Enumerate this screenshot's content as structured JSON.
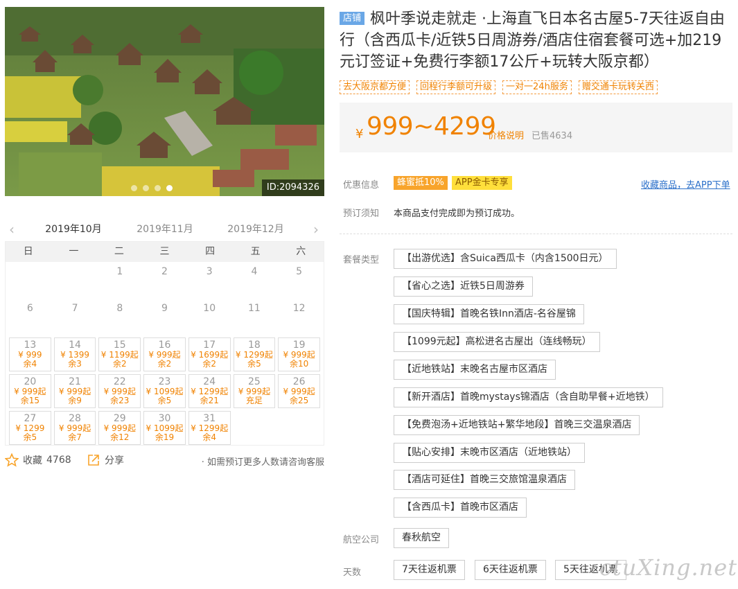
{
  "hero": {
    "id_label": "ID:2094326",
    "dots": 4,
    "active_dot": 3
  },
  "calendar": {
    "months": [
      "2019年10月",
      "2019年11月",
      "2019年12月"
    ],
    "weekdays": [
      "日",
      "一",
      "二",
      "三",
      "四",
      "五",
      "六"
    ],
    "days": [
      {
        "d": ""
      },
      {
        "d": ""
      },
      {
        "d": "1"
      },
      {
        "d": "2"
      },
      {
        "d": "3"
      },
      {
        "d": "4"
      },
      {
        "d": "5"
      },
      {
        "d": "6"
      },
      {
        "d": "7"
      },
      {
        "d": "8"
      },
      {
        "d": "9"
      },
      {
        "d": "10"
      },
      {
        "d": "11"
      },
      {
        "d": "12"
      },
      {
        "d": "13",
        "p": "¥ 999",
        "s": "余4"
      },
      {
        "d": "14",
        "p": "¥ 1399",
        "s": "余3"
      },
      {
        "d": "15",
        "p": "¥ 1199起",
        "s": "余2"
      },
      {
        "d": "16",
        "p": "¥ 999起",
        "s": "余2"
      },
      {
        "d": "17",
        "p": "¥ 1699起",
        "s": "余2"
      },
      {
        "d": "18",
        "p": "¥ 1299起",
        "s": "余5"
      },
      {
        "d": "19",
        "p": "¥ 999起",
        "s": "余10"
      },
      {
        "d": "20",
        "p": "¥ 999起",
        "s": "余15"
      },
      {
        "d": "21",
        "p": "¥ 999起",
        "s": "余9"
      },
      {
        "d": "22",
        "p": "¥ 999起",
        "s": "余23"
      },
      {
        "d": "23",
        "p": "¥ 1099起",
        "s": "余5"
      },
      {
        "d": "24",
        "p": "¥ 1299起",
        "s": "余21"
      },
      {
        "d": "25",
        "p": "¥ 999起",
        "s": "充足"
      },
      {
        "d": "26",
        "p": "¥ 999起",
        "s": "余25"
      },
      {
        "d": "27",
        "p": "¥ 1299",
        "s": "余5"
      },
      {
        "d": "28",
        "p": "¥ 999起",
        "s": "余7"
      },
      {
        "d": "29",
        "p": "¥ 999起",
        "s": "余12"
      },
      {
        "d": "30",
        "p": "¥ 1099起",
        "s": "余19"
      },
      {
        "d": "31",
        "p": "¥ 1299起",
        "s": "余4"
      }
    ]
  },
  "actions": {
    "fav_label": "收藏",
    "fav_count": "4768",
    "share_label": "分享",
    "note": "· 如需预订更多人数请咨询客服"
  },
  "product": {
    "shop_tag": "店铺",
    "title": "枫叶季说走就走 ·上海直飞日本名古屋5-7天往返自由行（含西瓜卡/近铁5日周游券/酒店住宿套餐可选+加219元订签证+免费行李额17公斤+玩转大阪京都）",
    "tags": [
      "去大阪京都方便",
      "回程行李额可升级",
      "一对一24h服务",
      "赠交通卡玩转关西"
    ],
    "price_symbol": "¥",
    "price": "999~4299",
    "price_note": "价格说明",
    "sold": "已售4634"
  },
  "promo": {
    "label": "优惠信息",
    "badge1": "蜂蜜抵10%",
    "badge2": "APP金卡专享",
    "app_link": "收藏商品，去APP下单"
  },
  "booking": {
    "label": "预订须知",
    "notice": "本商品支付完成即为预订成功。"
  },
  "package": {
    "label": "套餐类型",
    "options": [
      "【出游优选】含Suica西瓜卡（内含1500日元）",
      "【省心之选】近铁5日周游券",
      "【国庆特辑】首晚名铁Inn酒店-名谷屋锦",
      "【1099元起】高松进名古屋出（连线畅玩）",
      "【近地铁站】末晚名古屋市区酒店",
      "【新开酒店】首晚mystays锦酒店（含自助早餐+近地铁）",
      "【免费泡汤+近地铁站+繁华地段】首晚三交温泉酒店",
      "【贴心安排】末晚市区酒店（近地铁站）",
      "【酒店可延住】首晚三交旅馆温泉酒店",
      "【含西瓜卡】首晚市区酒店"
    ]
  },
  "airline": {
    "label": "航空公司",
    "value": "春秋航空"
  },
  "days": {
    "label": "天数",
    "options": [
      "7天往返机票",
      "6天往返机票",
      "5天往返机票"
    ]
  },
  "watermark": "ctuXing.net",
  "colors": {
    "accent": "#f08200",
    "shop_blue": "#6aa7e6",
    "link": "#2a6fc9"
  }
}
